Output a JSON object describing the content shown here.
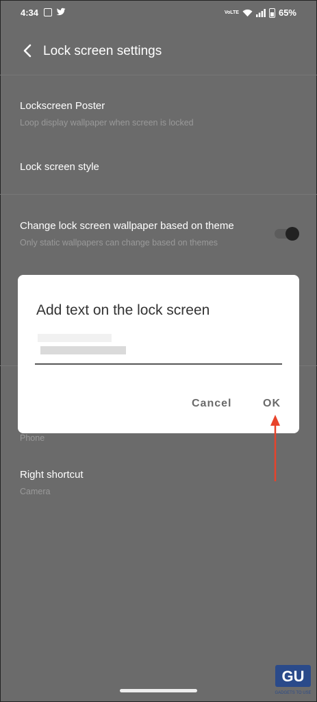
{
  "statusbar": {
    "time": "4:34",
    "notification_icons": [
      "screenshot-icon",
      "twitter-icon"
    ],
    "network": "VoLTE",
    "battery": "65%"
  },
  "header": {
    "back_icon": "chevron-left-icon",
    "title": "Lock screen settings"
  },
  "settings": [
    {
      "title": "Lockscreen Poster",
      "subtitle": "Loop display wallpaper when screen is locked"
    },
    {
      "title": "Lock screen style",
      "subtitle": ""
    },
    {
      "title": "Change lock screen wallpaper based on theme",
      "subtitle": "Only static wallpapers can change based on themes",
      "toggle": true,
      "toggle_on": true
    },
    {
      "title": "",
      "subtitle": "Phone"
    },
    {
      "title": "Right shortcut",
      "subtitle": "Camera"
    }
  ],
  "dialog": {
    "title": "Add text on the lock screen",
    "input_value": "",
    "cancel_label": "Cancel",
    "ok_label": "OK"
  },
  "colors": {
    "dim_background": "#6b6b6b",
    "dialog_bg": "#ffffff",
    "annotation_arrow": "#e8432b"
  },
  "watermark": "GADGETS TO USE"
}
